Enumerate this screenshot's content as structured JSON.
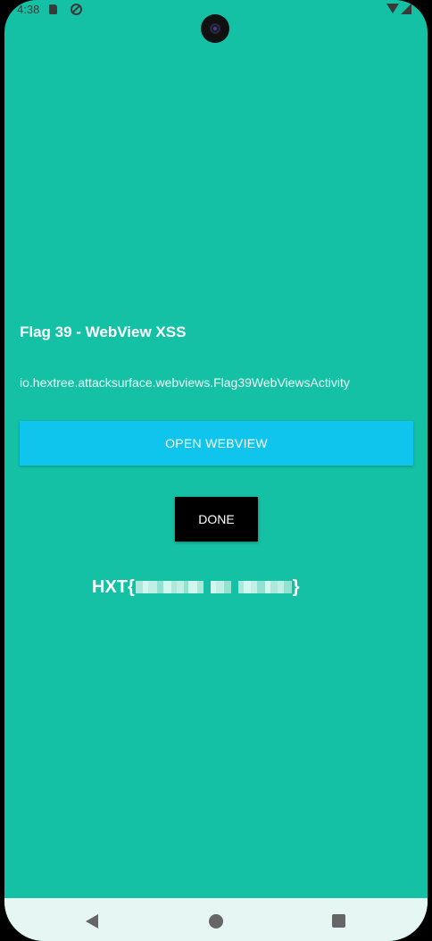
{
  "status_bar": {
    "time": "4:38",
    "icons": [
      "sd-card-icon",
      "sync-icon",
      "wifi-icon",
      "signal-icon"
    ]
  },
  "activity": {
    "title": "Flag 39 - WebView XSS",
    "class_name": "io.hextree.attacksurface.webviews.Flag39WebViewsActivity"
  },
  "buttons": {
    "open_webview": "OPEN WEBVIEW",
    "done": "DONE"
  },
  "flag": {
    "prefix": "HXT{",
    "suffix": "}",
    "value_redacted": true
  },
  "nav_bar": {
    "icons": [
      "back-icon",
      "home-icon",
      "recents-icon"
    ]
  },
  "colors": {
    "background": "#15c1a4",
    "open_button": "#0fc5ee",
    "done_button": "#000000",
    "nav_bar": "#e6f7f3"
  }
}
